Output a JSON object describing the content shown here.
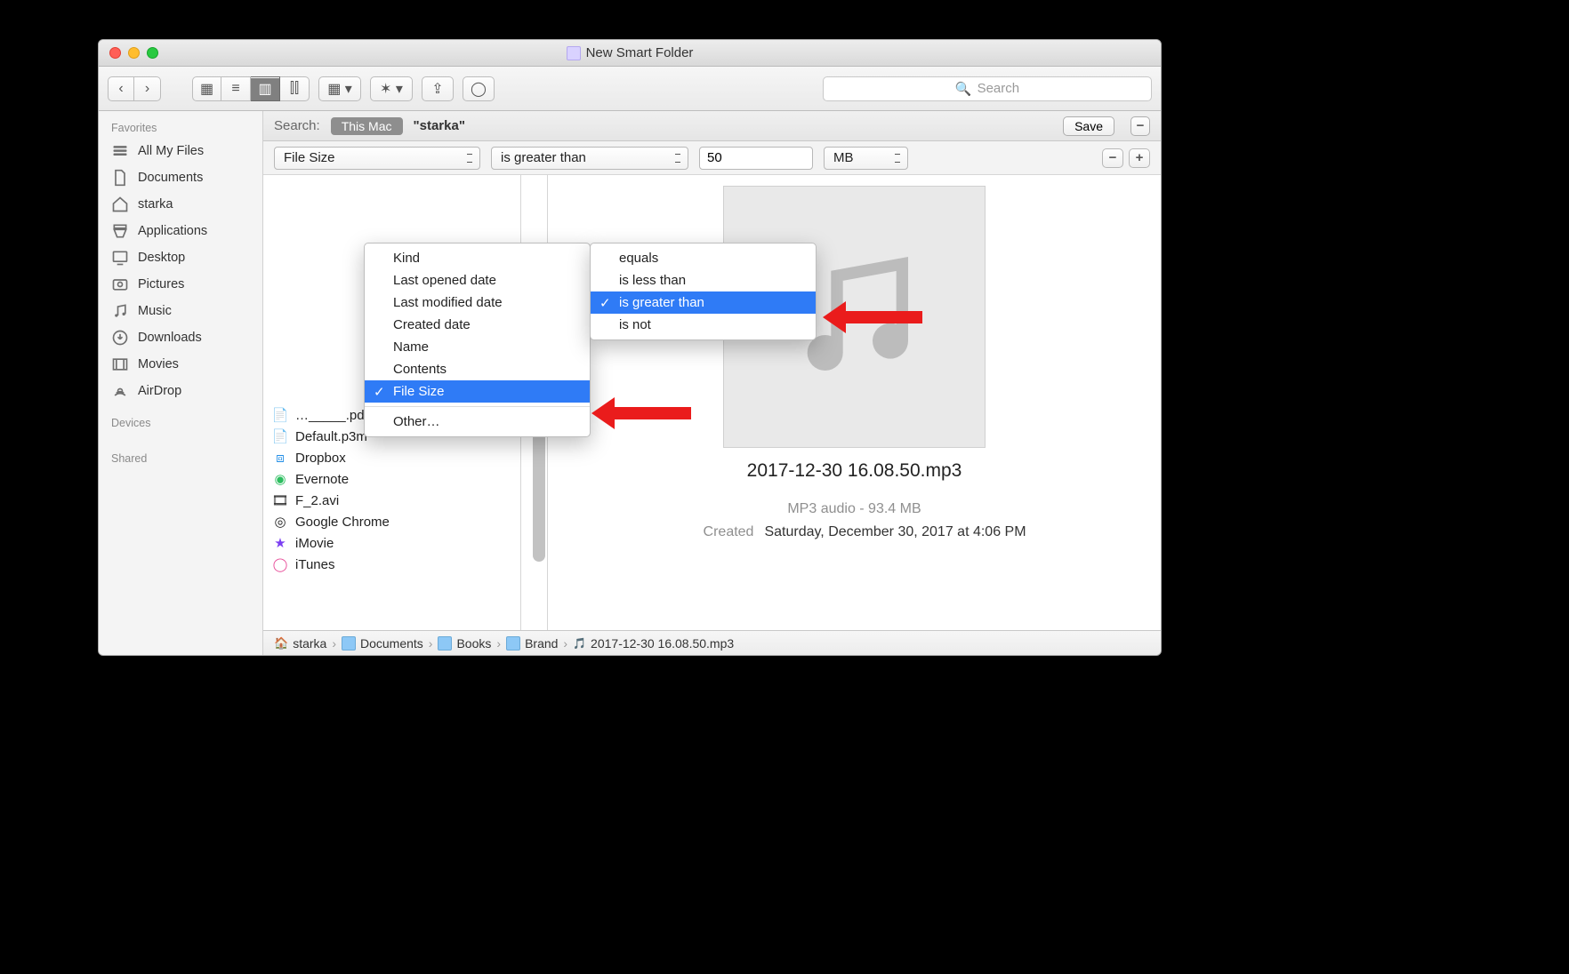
{
  "window": {
    "title": "New Smart Folder"
  },
  "toolbar": {
    "search_placeholder": "Search"
  },
  "sidebar": {
    "section_favorites": "Favorites",
    "section_devices": "Devices",
    "section_shared": "Shared",
    "items": [
      {
        "label": "All My Files",
        "icon": "all-my-files"
      },
      {
        "label": "Documents",
        "icon": "documents"
      },
      {
        "label": "starka",
        "icon": "home"
      },
      {
        "label": "Applications",
        "icon": "applications"
      },
      {
        "label": "Desktop",
        "icon": "desktop"
      },
      {
        "label": "Pictures",
        "icon": "pictures"
      },
      {
        "label": "Music",
        "icon": "music"
      },
      {
        "label": "Downloads",
        "icon": "downloads"
      },
      {
        "label": "Movies",
        "icon": "movies"
      },
      {
        "label": "AirDrop",
        "icon": "airdrop"
      }
    ]
  },
  "search_scope": {
    "label": "Search:",
    "scope_selected": "This Mac",
    "folder": "\"starka\"",
    "save": "Save"
  },
  "criteria": {
    "attribute_selected": "File Size",
    "attribute_options": [
      "Kind",
      "Last opened date",
      "Last modified date",
      "Created date",
      "Name",
      "Contents",
      "File Size"
    ],
    "attribute_other": "Other…",
    "comparator_selected": "is greater than",
    "comparator_options": [
      "equals",
      "is less than",
      "is greater than",
      "is not"
    ],
    "value": "50",
    "unit": "MB"
  },
  "file_list": {
    "visible_numbers": [
      "3",
      "3"
    ],
    "items": [
      "____.pdf",
      "Default.p3m",
      "Dropbox",
      "Evernote",
      "F_2.avi",
      "Google Chrome",
      "iMovie",
      "iTunes"
    ]
  },
  "preview": {
    "filename": "2017-12-30 16.08.50.mp3",
    "kind_size": "MP3 audio - 93.4 MB",
    "created_label": "Created",
    "created_value": "Saturday, December 30, 2017 at 4:06 PM"
  },
  "path": {
    "items": [
      "starka",
      "Documents",
      "Books",
      "Brand",
      "2017-12-30 16.08.50.mp3"
    ]
  }
}
